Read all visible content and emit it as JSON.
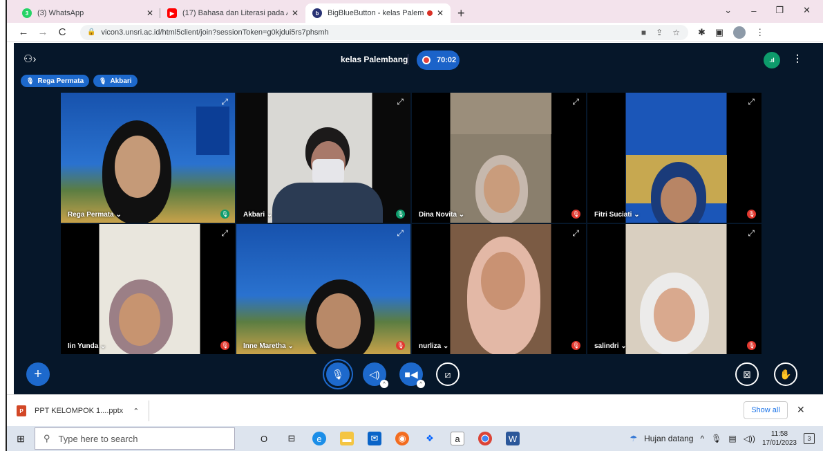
{
  "browser": {
    "tabs": [
      {
        "title": "(3) WhatsApp",
        "icon": "whatsapp-icon",
        "color": "#25d366",
        "badge": "3"
      },
      {
        "title": "(17) Bahasa dan Literasi pada An",
        "icon": "youtube-icon",
        "color": "#ff0000",
        "badge": "▶"
      },
      {
        "title": "BigBlueButton - kelas Palemb",
        "icon": "bigbluebutton-icon",
        "color": "#283274",
        "badge": "b"
      }
    ],
    "url": "vicon3.unsri.ac.id/html5client/join?sessionToken=g0kjdui5rs7phsmh"
  },
  "meeting": {
    "title": "kelas Palembang",
    "timer": "70:02",
    "talkers": [
      "Rega Permata",
      "Akbari"
    ]
  },
  "participants": [
    {
      "name": "Rega Permata",
      "mic": "on",
      "speaking": true
    },
    {
      "name": "Akbari",
      "mic": "on",
      "speaking": true
    },
    {
      "name": "Dina Novita",
      "mic": "off",
      "speaking": false
    },
    {
      "name": "Fitri Suciati",
      "mic": "off",
      "speaking": false
    },
    {
      "name": "Iin Yunda",
      "mic": "off",
      "speaking": false
    },
    {
      "name": "Inne Maretha",
      "mic": "off",
      "speaking": false
    },
    {
      "name": "nurliza",
      "mic": "off",
      "speaking": false
    },
    {
      "name": "salindri",
      "mic": "off",
      "speaking": false
    }
  ],
  "downloads": {
    "file": "PPT KELOMPOK 1....pptx",
    "show_all": "Show all"
  },
  "taskbar": {
    "search_placeholder": "Type here to search",
    "weather": "Hujan datang",
    "time": "11:58",
    "date": "17/01/2023",
    "notifications": "3"
  },
  "colors": {
    "bbb_background": "#06172a",
    "accent": "#1d69cc",
    "mic_on": "#0d9b6b",
    "mic_off": "#e2382f"
  }
}
